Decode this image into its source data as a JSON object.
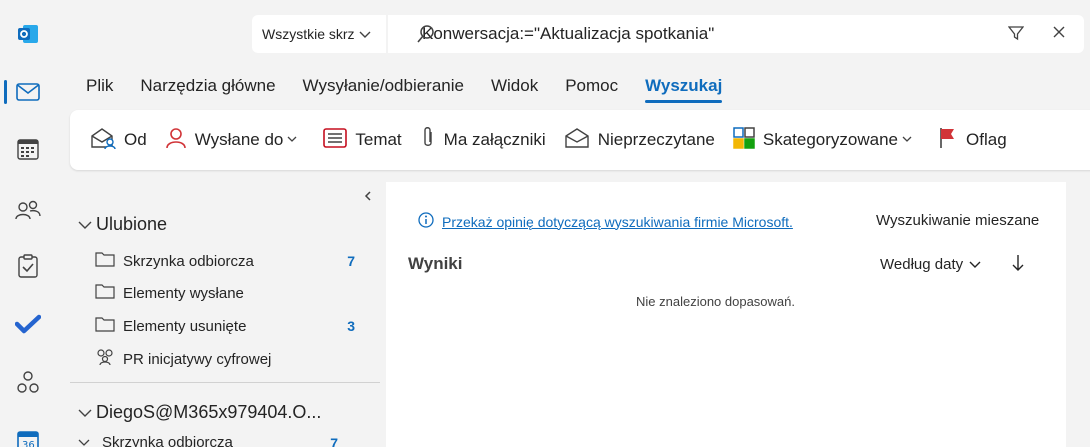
{
  "search": {
    "scope_label": "Wszystkie skrz",
    "query": "Konwersacja:=\"Aktualizacja spotkania\""
  },
  "tabs": [
    {
      "label": "Plik"
    },
    {
      "label": "Narzędzia główne"
    },
    {
      "label": "Wysyłanie/odbieranie"
    },
    {
      "label": "Widok"
    },
    {
      "label": "Pomoc"
    },
    {
      "label": "Wyszukaj",
      "active": true
    }
  ],
  "ribbon": {
    "from": "Od",
    "sent_to": "Wysłane do",
    "subject": "Temat",
    "has_attachments": "Ma załączniki",
    "unread": "Nieprzeczytane",
    "categorized": "Skategoryzowane",
    "flagged": "Oflag"
  },
  "folders": {
    "favorites_label": "Ulubione",
    "favorites": [
      {
        "label": "Skrzynka odbiorcza",
        "count": "7"
      },
      {
        "label": "Elementy wysłane",
        "count": ""
      },
      {
        "label": "Elementy usunięte",
        "count": "3"
      },
      {
        "label": "PR inicjatywy cyfrowej",
        "count": ""
      }
    ],
    "account_label": "DiegoS@M365x979404.O...",
    "account_items": [
      {
        "label": "Skrzynka odbiorcza",
        "count": "7"
      }
    ]
  },
  "main": {
    "feedback_link": "Przekaż opinię dotyczącą wyszukiwania firmie Microsoft.",
    "mixed_search": "Wyszukiwanie mieszane",
    "results_heading": "Wyniki",
    "sort_label": "Według daty",
    "no_matches": "Nie znaleziono dopasowań."
  },
  "colors": {
    "accent": "#0f6cbd",
    "flag_red": "#d13438"
  }
}
